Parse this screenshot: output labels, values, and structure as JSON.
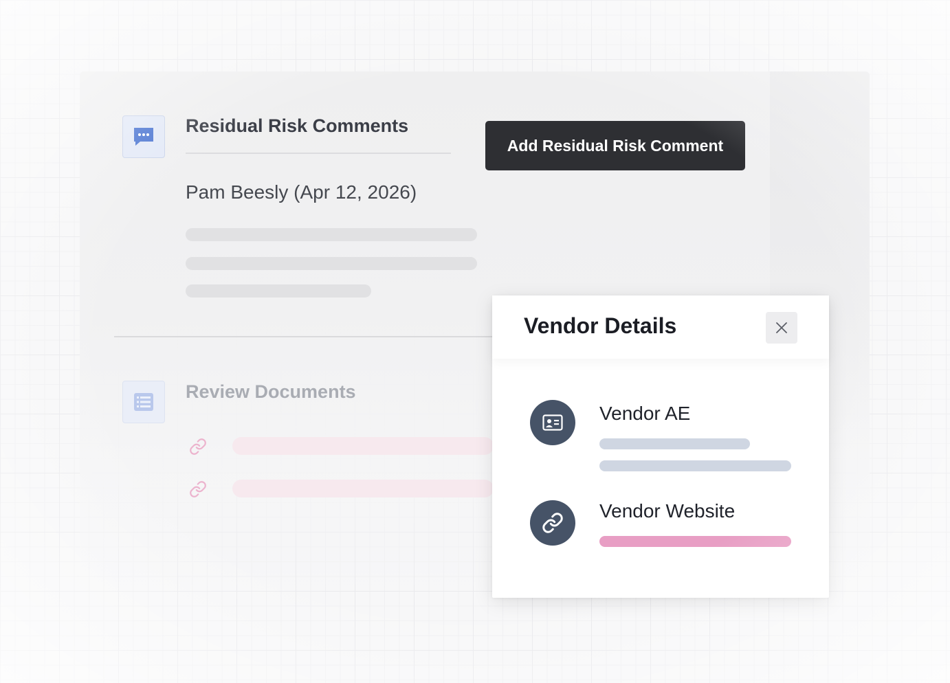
{
  "colors": {
    "button_bg": "#2e2f33",
    "accent_blue": "#4a74d1",
    "link_pink": "#e89ec4",
    "avatar_bg": "#465367"
  },
  "residual_risk": {
    "icon": "chat-bubble-icon",
    "title": "Residual Risk Comments",
    "add_button_label": "Add Residual Risk Comment",
    "comment_author": "Pam Beesly (Apr 12, 2026)"
  },
  "review_documents": {
    "icon": "list-icon",
    "title": "Review Documents",
    "link_icon": "link-icon"
  },
  "vendor_modal": {
    "title": "Vendor Details",
    "close_icon": "close-icon",
    "items": [
      {
        "icon": "id-card-icon",
        "label": "Vendor AE"
      },
      {
        "icon": "link-icon",
        "label": "Vendor Website"
      }
    ]
  }
}
